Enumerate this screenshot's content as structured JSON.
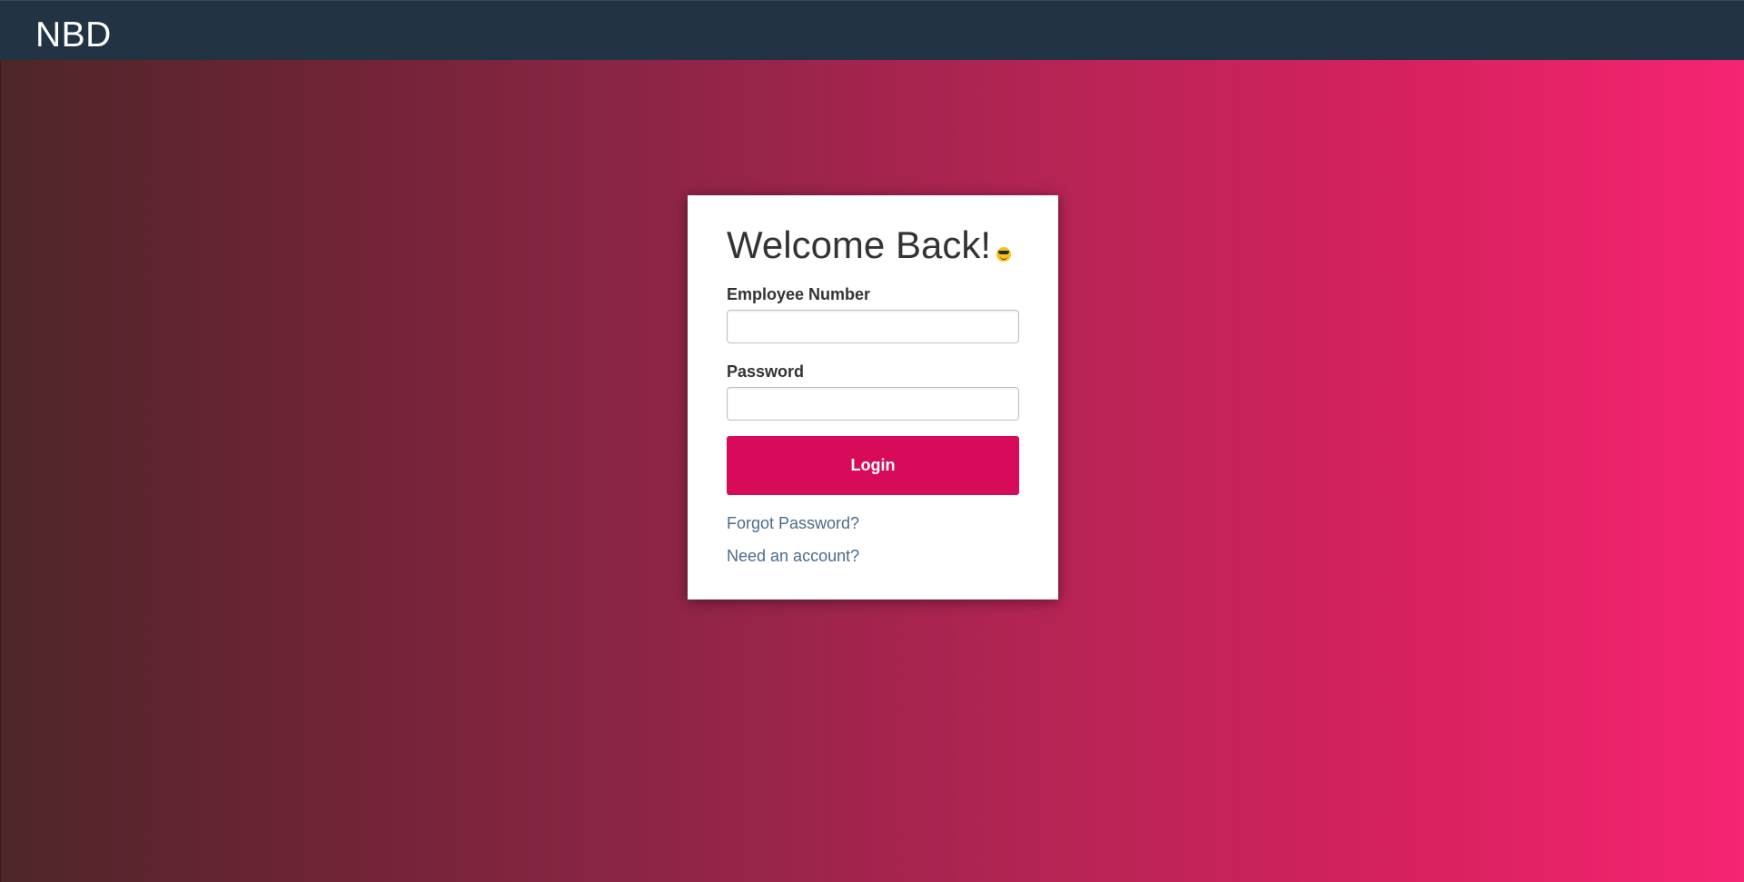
{
  "navbar": {
    "brand": "NBD",
    "background_color": "#223344"
  },
  "background": {
    "gradient_colors": [
      "#4e2629",
      "#f62473"
    ]
  },
  "login_card": {
    "heading": "Welcome Back!",
    "heading_emoji_icon": "smiling-face-with-sunglasses-icon",
    "employee_number": {
      "label": "Employee Number",
      "value": "",
      "placeholder": ""
    },
    "password": {
      "label": "Password",
      "value": "",
      "placeholder": ""
    },
    "login_button_label": "Login",
    "login_button_color": "#d80b5a",
    "forgot_password_link": "Forgot Password?",
    "need_account_link": "Need an account?",
    "link_color": "#4c6b8c"
  }
}
